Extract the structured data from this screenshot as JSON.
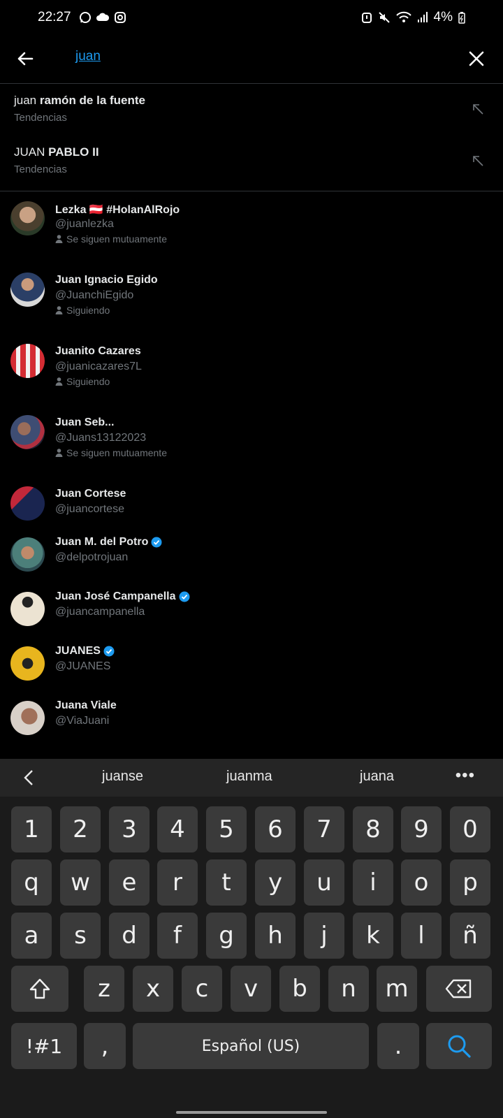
{
  "status_bar": {
    "time": "22:27",
    "battery": "4%"
  },
  "search": {
    "query": "juan"
  },
  "trends": [
    {
      "prefix": "juan",
      "bold": "ramón de la fuente",
      "subtitle": "Tendencias"
    },
    {
      "prefix": "JUAN",
      "bold": "PABLO II",
      "subtitle": "Tendencias"
    }
  ],
  "users": [
    {
      "name": "Lezka 🇦🇹 #HolanAlRojo",
      "handle": "@juanlezka",
      "relation": "Se siguen mutuamente",
      "verified": false
    },
    {
      "name": "Juan Ignacio Egido",
      "handle": "@JuanchiEgido",
      "relation": "Siguiendo",
      "verified": false
    },
    {
      "name": "Juanito Cazares",
      "handle": "@juanicazares7L",
      "relation": "Siguiendo",
      "verified": false
    },
    {
      "name": "Juan Seb...",
      "handle": "@Juans13122023",
      "relation": "Se siguen mutuamente",
      "verified": false
    },
    {
      "name": "Juan Cortese",
      "handle": "@juancortese",
      "relation": "",
      "verified": false
    },
    {
      "name": "Juan M. del Potro",
      "handle": "@delpotrojuan",
      "relation": "",
      "verified": true
    },
    {
      "name": "Juan José Campanella",
      "handle": "@juancampanella",
      "relation": "",
      "verified": true
    },
    {
      "name": "JUANES",
      "handle": "@JUANES",
      "relation": "",
      "verified": true
    },
    {
      "name": "Juana Viale",
      "handle": "@ViaJuani",
      "relation": "",
      "verified": false
    }
  ],
  "keyboard": {
    "suggestions": [
      "juanse",
      "juanma",
      "juana"
    ],
    "more": "•••",
    "row_numbers": [
      "1",
      "2",
      "3",
      "4",
      "5",
      "6",
      "7",
      "8",
      "9",
      "0"
    ],
    "row1": [
      "q",
      "w",
      "e",
      "r",
      "t",
      "y",
      "u",
      "i",
      "o",
      "p"
    ],
    "row2": [
      "a",
      "s",
      "d",
      "f",
      "g",
      "h",
      "j",
      "k",
      "l",
      "ñ"
    ],
    "row3": [
      "z",
      "x",
      "c",
      "v",
      "b",
      "n",
      "m"
    ],
    "symbols": "!#1",
    "comma": ",",
    "space": "Español (US)",
    "period": "."
  },
  "colors": {
    "accent": "#1d9bf0",
    "verified": "#1d9bf0",
    "background": "#000000"
  }
}
